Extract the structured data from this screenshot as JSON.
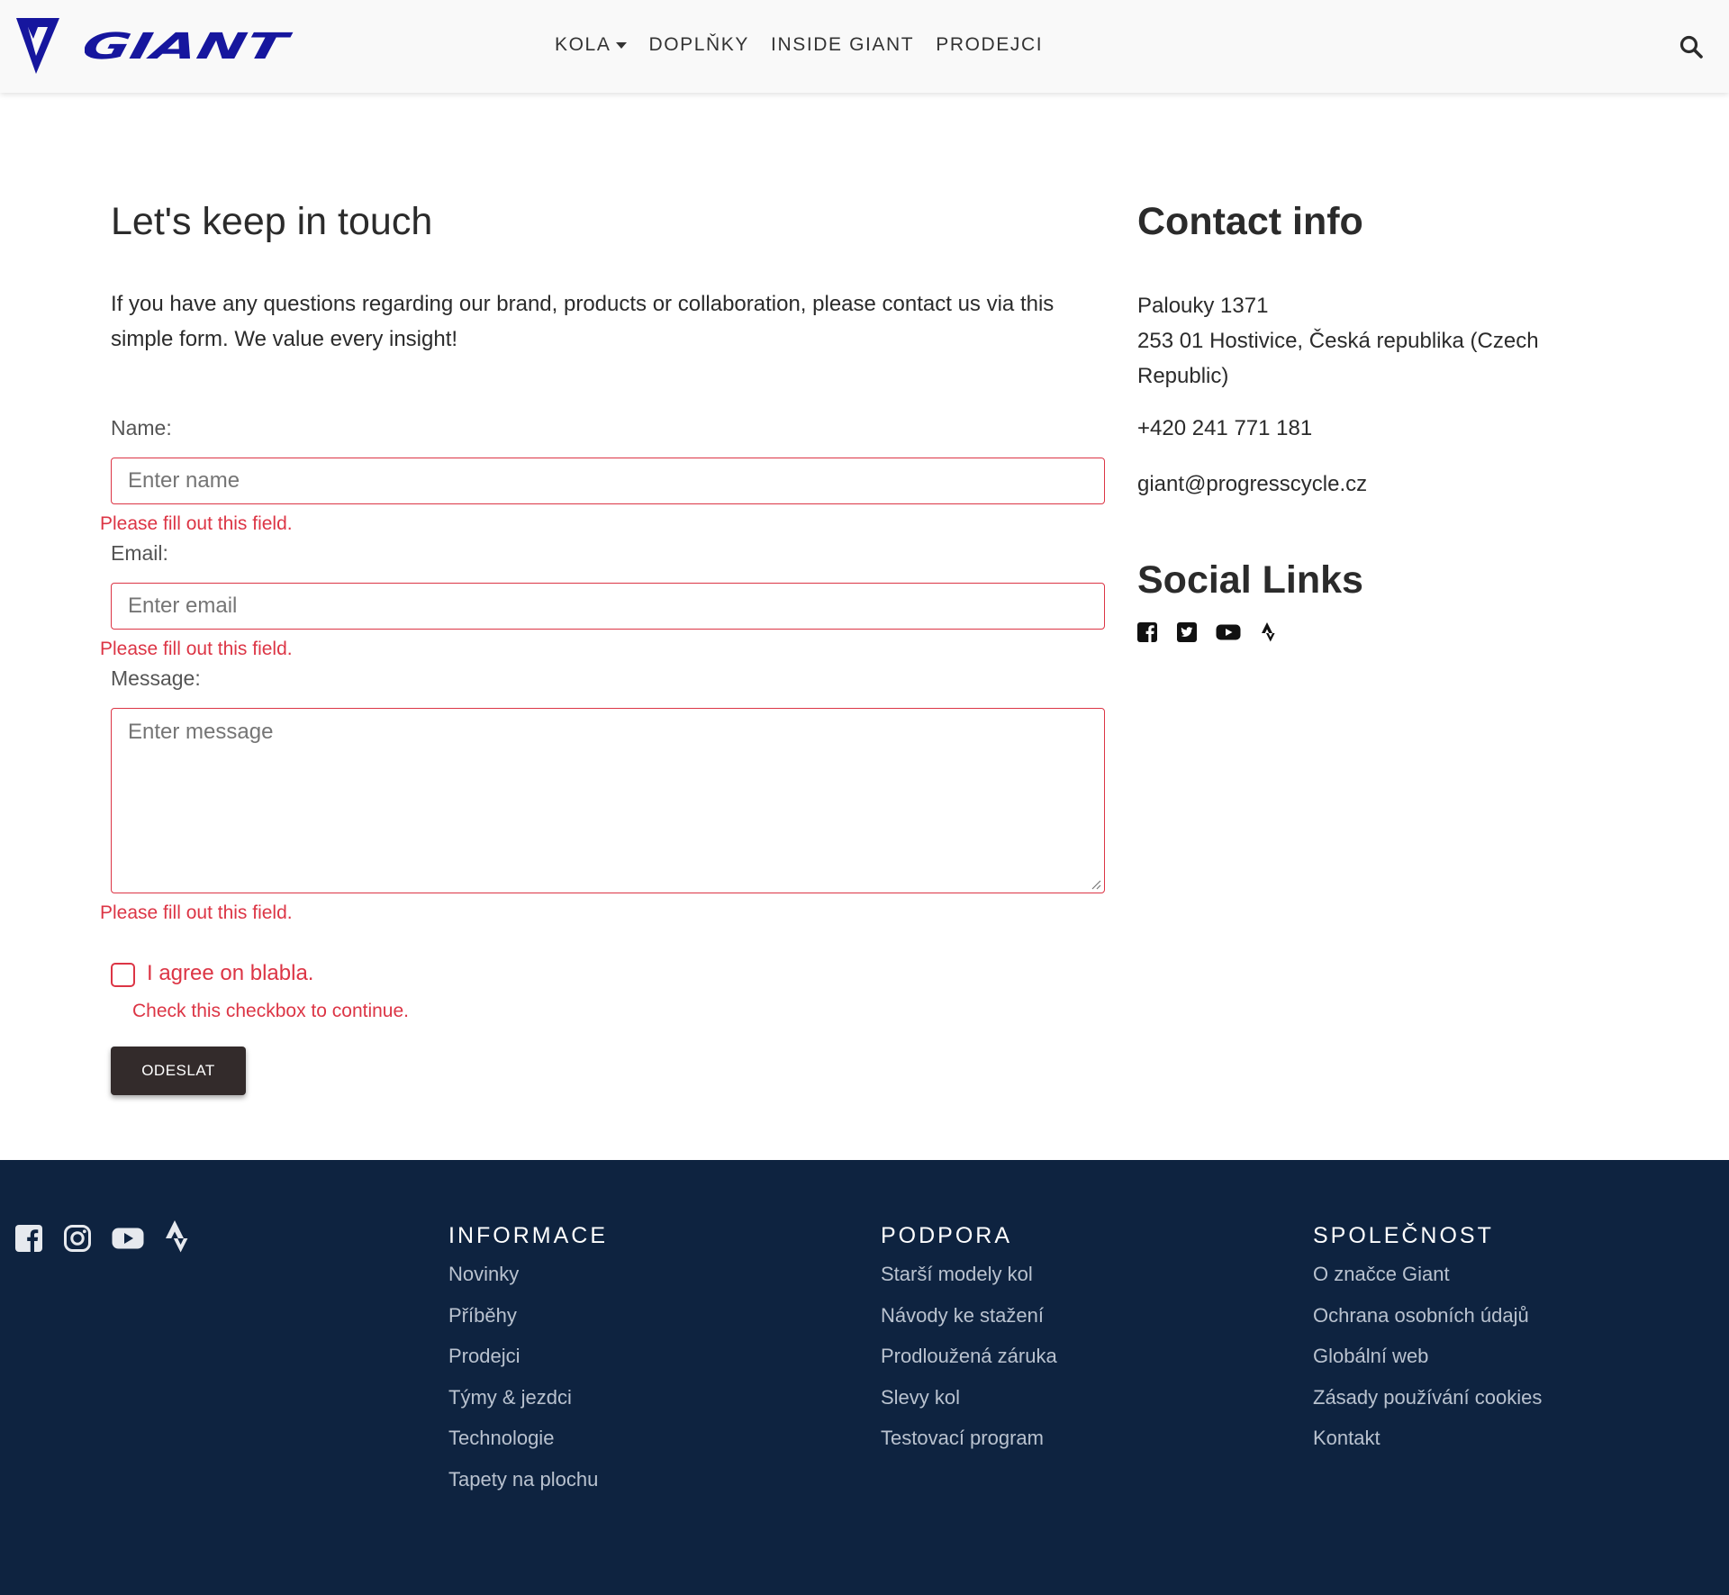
{
  "header": {
    "brand": "GIANT",
    "nav": [
      "KOLA",
      "DOPLŇKY",
      "INSIDE GIANT",
      "PRODEJCI"
    ]
  },
  "form": {
    "title": "Let's keep in touch",
    "intro": "If you have any questions regarding our brand, products or collaboration, please contact us via this simple form. We value every insight!",
    "name_label": "Name:",
    "name_placeholder": "Enter name",
    "email_label": "Email:",
    "email_placeholder": "Enter email",
    "message_label": "Message:",
    "message_placeholder": "Enter message",
    "field_error": "Please fill out this field.",
    "agree_label": "I agree on blabla.",
    "agree_error": "Check this checkbox to continue.",
    "submit_label": "ODESLAT"
  },
  "contact": {
    "title": "Contact info",
    "address_line1": "Palouky 1371",
    "address_line2": "253 01 Hostivice, Česká republika (Czech Republic)",
    "phone": "+420 241 771 181",
    "email": "giant@progresscycle.cz",
    "social_title": "Social Links",
    "social_icons": [
      "facebook-icon",
      "twitter-icon",
      "youtube-icon",
      "strava-icon"
    ]
  },
  "footer": {
    "social_icons": [
      "facebook-icon",
      "instagram-icon",
      "youtube-icon",
      "strava-icon"
    ],
    "columns": [
      {
        "title": "INFORMACE",
        "links": [
          "Novinky",
          "Příběhy",
          "Prodejci",
          "Týmy & jezdci",
          "Technologie",
          "Tapety na plochu"
        ]
      },
      {
        "title": "PODPORA",
        "links": [
          "Starší modely kol",
          "Návody ke stažení",
          "Prodloužená záruka",
          "Slevy kol",
          "Testovací program"
        ]
      },
      {
        "title": "SPOLEČNOST",
        "links": [
          "O značce Giant",
          "Ochrana osobních údajů",
          "Globální web",
          "Zásady používání cookies",
          "Kontakt"
        ]
      }
    ]
  },
  "colors": {
    "brand_blue": "#16169e",
    "error_red": "#dc3545",
    "footer_bg": "#0e2340",
    "button_bg": "#332b2b"
  }
}
